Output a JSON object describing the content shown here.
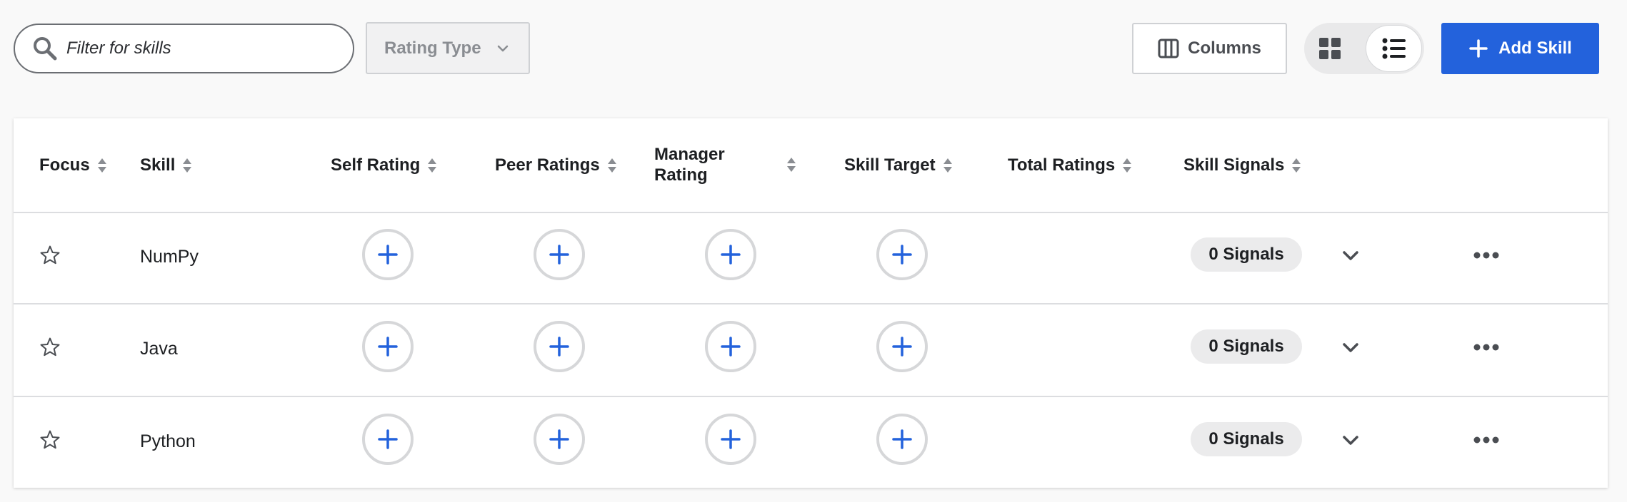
{
  "toolbar": {
    "search_placeholder": "Filter for skills",
    "rating_type_label": "Rating Type",
    "columns_label": "Columns",
    "add_skill_label": "Add Skill",
    "view_mode": "list"
  },
  "colors": {
    "accent": "#2362dc",
    "background": "#f9f9f9",
    "border": "#dcdde0"
  },
  "table": {
    "headers": {
      "focus": "Focus",
      "skill": "Skill",
      "self_rating": "Self Rating",
      "peer_ratings": "Peer Ratings",
      "manager_rating_line1": "Manager",
      "manager_rating_line2": "Rating",
      "skill_target": "Skill Target",
      "total_ratings": "Total Ratings",
      "skill_signals": "Skill Signals"
    },
    "rows": [
      {
        "skill": "NumPy",
        "signals": "0 Signals"
      },
      {
        "skill": "Java",
        "signals": "0 Signals"
      },
      {
        "skill": "Python",
        "signals": "0 Signals"
      }
    ]
  },
  "icons": [
    "search-icon",
    "chevron-down-icon",
    "columns-icon",
    "grid-view-icon",
    "list-view-icon",
    "plus-icon",
    "star-icon",
    "sort-icon",
    "more-icon"
  ]
}
